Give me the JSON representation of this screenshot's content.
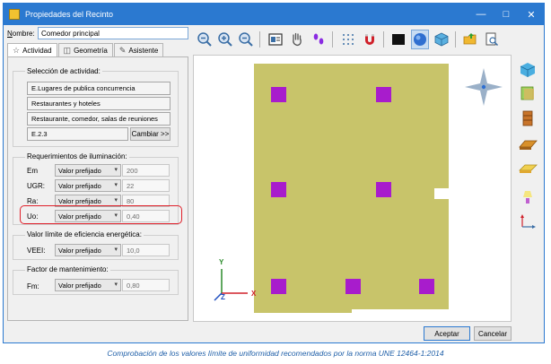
{
  "window": {
    "title": "Propiedades del Recinto",
    "minimize": "—",
    "maximize": "□",
    "close": "✕"
  },
  "name_field": {
    "label_prefix": "N",
    "label_rest": "ombre:",
    "value": "Comedor principal"
  },
  "tabs": [
    {
      "label": "Actividad",
      "icon": "star-icon",
      "active": true
    },
    {
      "label": "Geometría",
      "icon": "cube-icon",
      "active": false
    },
    {
      "label": "Asistente",
      "icon": "wand-icon",
      "active": false
    }
  ],
  "activity": {
    "title": "Selección de actividad:",
    "lines": [
      "E.Lugares de publica concurrencia",
      "Restaurantes y hoteles",
      "Restaurante, comedor, salas de reuniones"
    ],
    "code": "E.2.3",
    "change_button": "Cambiar >>"
  },
  "lighting": {
    "title": "Requerimientos de iluminación:",
    "rows": [
      {
        "label": "Em",
        "option": "Valor prefijado",
        "value": "200"
      },
      {
        "label": "UGR:",
        "option": "Valor prefijado",
        "value": "22"
      },
      {
        "label": "Ra:",
        "option": "Valor prefijado",
        "value": "80"
      },
      {
        "label": "Uo:",
        "option": "Valor prefijado",
        "value": "0,40"
      }
    ]
  },
  "efficiency": {
    "title": "Valor límite de eficiencia energética:",
    "label": "VEEI:",
    "option": "Valor prefijado",
    "value": "10,0"
  },
  "maintenance": {
    "title": "Factor de mantenimiento:",
    "label": "Fm:",
    "option": "Valor prefijado",
    "value": "0,80"
  },
  "axes": {
    "y": "Y",
    "x": "X",
    "z": "Z"
  },
  "buttons": {
    "accept": "Aceptar",
    "cancel": "Cancelar"
  },
  "caption": "Comprobación de los valores límite de uniformidad recomendados por la norma UNE 12464-1:2014",
  "colors": {
    "floor": "#c8c46a",
    "luminaire": "#a81ccc",
    "titlebar": "#2b79d0",
    "highlight": "#e0202a"
  }
}
